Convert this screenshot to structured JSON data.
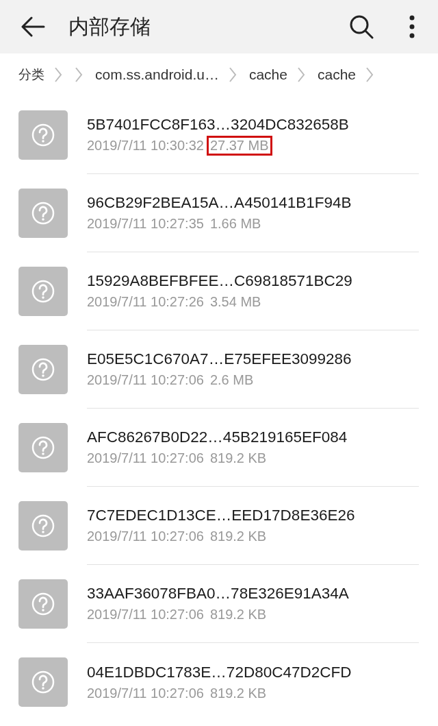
{
  "app_bar": {
    "title": "内部存储"
  },
  "breadcrumbs": [
    "分类",
    "com.ss.android.u…",
    "cache",
    "cache"
  ],
  "files": [
    {
      "name": "5B7401FCC8F163…3204DC832658B",
      "date": "2019/7/11 10:30:32",
      "size": "27.37 MB",
      "highlighted": true
    },
    {
      "name": "96CB29F2BEA15A…A450141B1F94B",
      "date": "2019/7/11 10:27:35",
      "size": "1.66 MB",
      "highlighted": false
    },
    {
      "name": "15929A8BEFBFEE…C69818571BC29",
      "date": "2019/7/11 10:27:26",
      "size": "3.54 MB",
      "highlighted": false
    },
    {
      "name": "E05E5C1C670A7…E75EFEE3099286",
      "date": "2019/7/11 10:27:06",
      "size": "2.6 MB",
      "highlighted": false
    },
    {
      "name": "AFC86267B0D22…45B219165EF084",
      "date": "2019/7/11 10:27:06",
      "size": "819.2 KB",
      "highlighted": false
    },
    {
      "name": "7C7EDEC1D13CE…EED17D8E36E26",
      "date": "2019/7/11 10:27:06",
      "size": "819.2 KB",
      "highlighted": false
    },
    {
      "name": "33AAF36078FBA0…78E326E91A34A",
      "date": "2019/7/11 10:27:06",
      "size": "819.2 KB",
      "highlighted": false
    },
    {
      "name": "04E1DBDC1783E…72D80C47D2CFD",
      "date": "2019/7/11 10:27:06",
      "size": "819.2 KB",
      "highlighted": false
    }
  ]
}
